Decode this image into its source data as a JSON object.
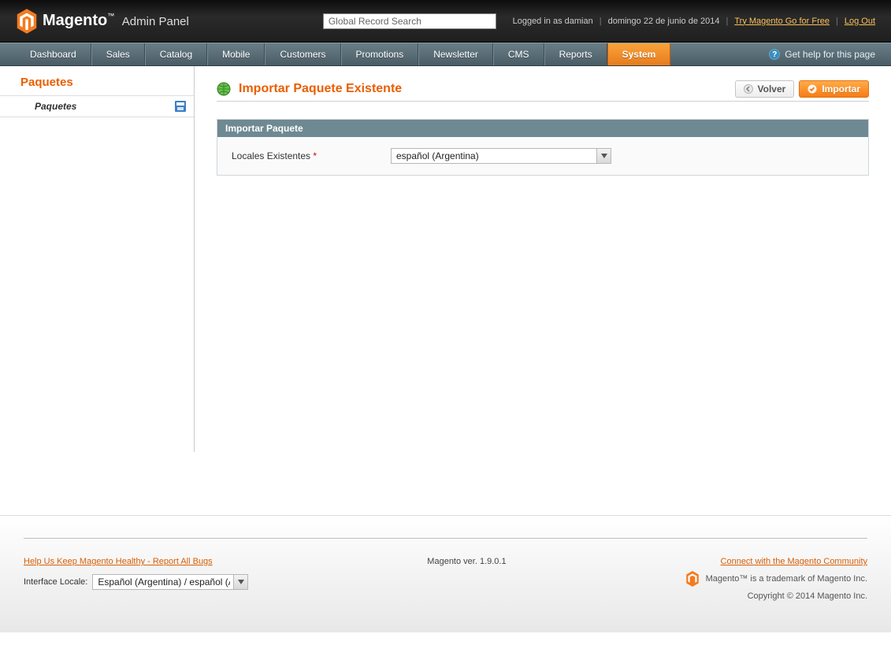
{
  "header": {
    "brand_main": "Magento",
    "brand_sub": "Admin Panel",
    "search_placeholder": "Global Record Search",
    "logged_in": "Logged in as damian",
    "date": "domingo 22 de junio de 2014",
    "try_link": "Try Magento Go for Free",
    "logout": "Log Out"
  },
  "nav": {
    "items": [
      "Dashboard",
      "Sales",
      "Catalog",
      "Mobile",
      "Customers",
      "Promotions",
      "Newsletter",
      "CMS",
      "Reports",
      "System"
    ],
    "active_index": 9,
    "help": "Get help for this page"
  },
  "sidebar": {
    "title": "Paquetes",
    "item_label": "Paquetes"
  },
  "page": {
    "title": "Importar Paquete Existente",
    "back_label": "Volver",
    "import_label": "Importar",
    "panel_title": "Importar Paquete",
    "field_label": "Locales Existentes",
    "select_value": "español (Argentina)"
  },
  "footer": {
    "bugs_link": "Help Us Keep Magento Healthy - Report All Bugs",
    "locale_label": "Interface Locale:",
    "locale_value": "Español (Argentina) / español (Ar",
    "version": "Magento ver. 1.9.0.1",
    "community_link": "Connect with the Magento Community",
    "trademark": "Magento™ is a trademark of Magento Inc.",
    "copyright": "Copyright © 2014 Magento Inc."
  }
}
